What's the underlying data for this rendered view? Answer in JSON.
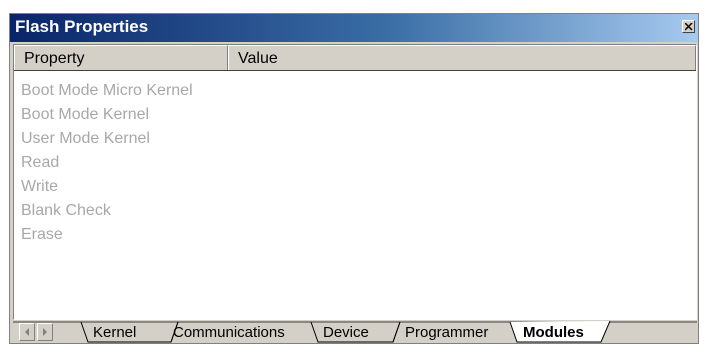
{
  "window": {
    "title": "Flash Properties"
  },
  "table": {
    "headers": {
      "property": "Property",
      "value": "Value"
    },
    "rows": [
      {
        "property": "Boot Mode Micro Kernel",
        "value": ""
      },
      {
        "property": "Boot Mode Kernel",
        "value": ""
      },
      {
        "property": "User Mode Kernel",
        "value": ""
      },
      {
        "property": "Read",
        "value": ""
      },
      {
        "property": "Write",
        "value": ""
      },
      {
        "property": "Blank Check",
        "value": ""
      },
      {
        "property": "Erase",
        "value": ""
      }
    ]
  },
  "tabs": [
    {
      "label": "Kernel",
      "active": false
    },
    {
      "label": "Communications",
      "active": false
    },
    {
      "label": "Device",
      "active": false
    },
    {
      "label": "Programmer",
      "active": false
    },
    {
      "label": "Modules",
      "active": true
    }
  ],
  "icons": {
    "close": "close-icon",
    "scroll_left": "arrow-left-icon",
    "scroll_right": "arrow-right-icon"
  },
  "colors": {
    "titlebar_start": "#0a246a",
    "titlebar_end": "#a6caf0",
    "disabled_text": "#a8a8a8",
    "chrome": "#d4d0c8"
  }
}
